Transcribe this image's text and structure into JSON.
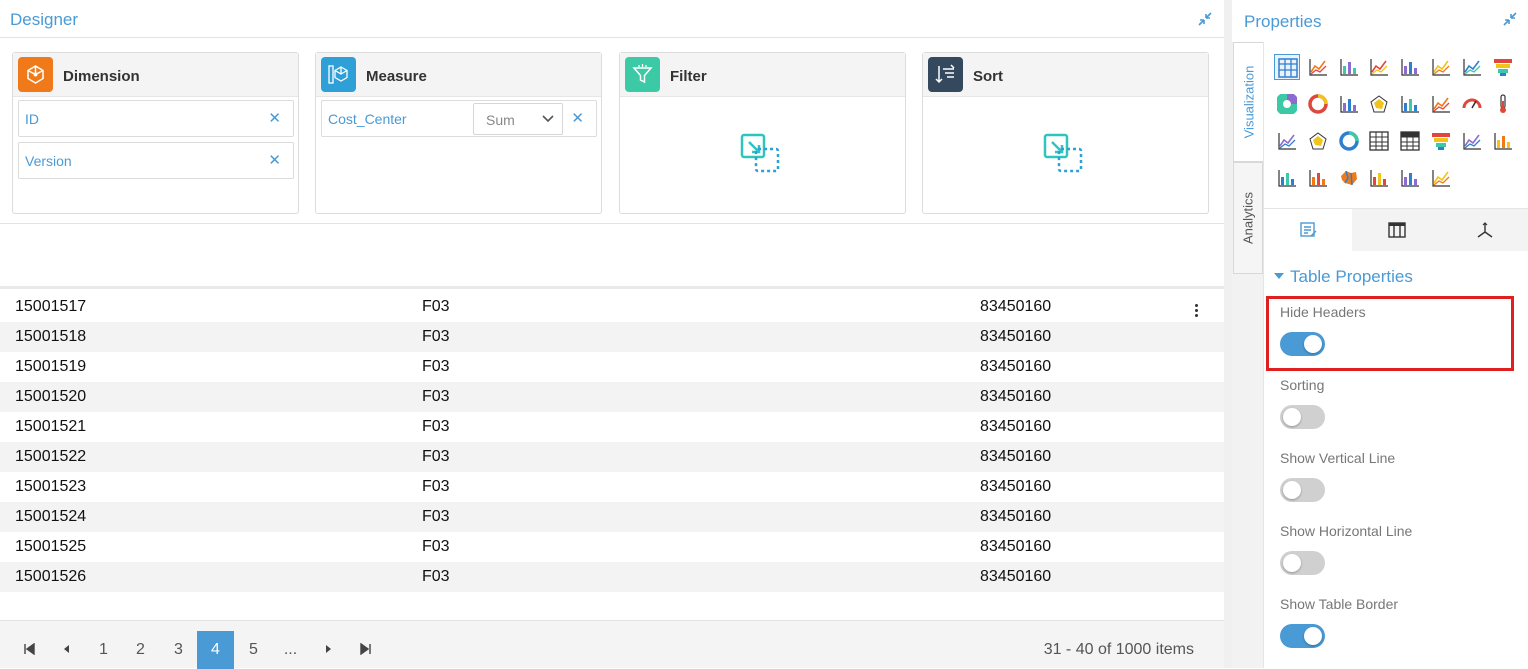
{
  "designer": {
    "title": "Designer",
    "cards": {
      "dimension": {
        "title": "Dimension",
        "items": [
          "ID",
          "Version"
        ]
      },
      "measure": {
        "title": "Measure",
        "item": "Cost_Center",
        "aggregation": "Sum"
      },
      "filter": {
        "title": "Filter"
      },
      "sort": {
        "title": "Sort"
      }
    },
    "rows": [
      [
        "15001517",
        "F03",
        "83450160"
      ],
      [
        "15001518",
        "F03",
        "83450160"
      ],
      [
        "15001519",
        "F03",
        "83450160"
      ],
      [
        "15001520",
        "F03",
        "83450160"
      ],
      [
        "15001521",
        "F03",
        "83450160"
      ],
      [
        "15001522",
        "F03",
        "83450160"
      ],
      [
        "15001523",
        "F03",
        "83450160"
      ],
      [
        "15001524",
        "F03",
        "83450160"
      ],
      [
        "15001525",
        "F03",
        "83450160"
      ],
      [
        "15001526",
        "F03",
        "83450160"
      ]
    ],
    "pager": {
      "pages": [
        "1",
        "2",
        "3",
        "4",
        "5",
        "..."
      ],
      "active_page": "4",
      "info": "31 - 40 of 1000 items"
    }
  },
  "properties": {
    "title": "Properties",
    "vertical_tabs": [
      "Visualization",
      "Analytics"
    ],
    "section_title": "Table Properties",
    "options": [
      {
        "label": "Hide Headers",
        "on": true
      },
      {
        "label": "Sorting",
        "on": false
      },
      {
        "label": "Show Vertical Line",
        "on": false
      },
      {
        "label": "Show Horizontal Line",
        "on": false
      },
      {
        "label": "Show Table Border",
        "on": true
      }
    ]
  },
  "colors": {
    "accent": "#4a9ad6",
    "dimension_badge": "#f07a1a",
    "measure_badge": "#2f9fd8",
    "filter_badge": "#3cc9a5",
    "sort_badge": "#34495e",
    "highlight": "#e02020"
  }
}
